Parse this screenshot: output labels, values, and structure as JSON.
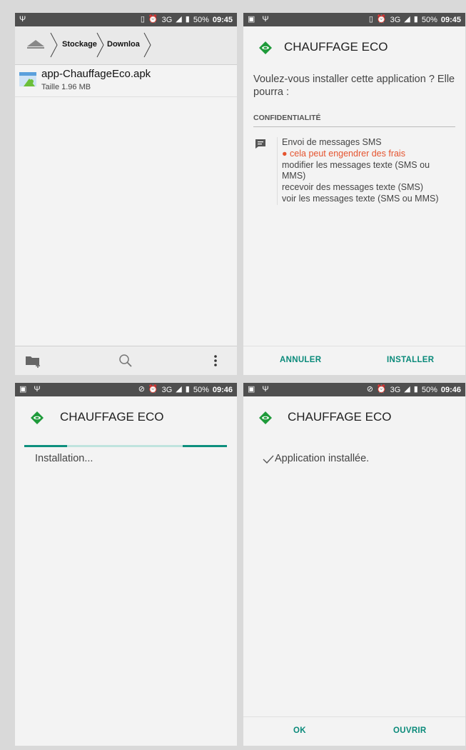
{
  "panels": {
    "file_manager": {
      "status": {
        "time": "09:45",
        "battery": "50%",
        "network": "3G"
      },
      "breadcrumb": [
        "Stockage",
        "Downloa"
      ],
      "file": {
        "name": "app-ChauffageEco.apk",
        "size": "Taille 1.96 MB"
      }
    },
    "installer_confirm": {
      "status": {
        "time": "09:45",
        "battery": "50%",
        "network": "3G"
      },
      "app_name": "CHAUFFAGE ECO",
      "question": "Voulez-vous installer cette application ? Elle pourra :",
      "section": "CONFIDENTIALITÉ",
      "permissions": {
        "sms_send": "Envoi de messages SMS",
        "warning": "cela peut engendrer des frais",
        "sms_modify": "modifier les messages texte (SMS ou MMS)",
        "sms_receive": "recevoir des messages texte (SMS)",
        "sms_read": "voir les messages texte (SMS ou MMS)"
      },
      "cancel_label": "ANNULER",
      "install_label": "INSTALLER"
    },
    "installing": {
      "status": {
        "time": "09:46",
        "battery": "50%",
        "network": "3G"
      },
      "app_name": "CHAUFFAGE ECO",
      "message": "Installation..."
    },
    "installed": {
      "status": {
        "time": "09:46",
        "battery": "50%",
        "network": "3G"
      },
      "app_name": "CHAUFFAGE ECO",
      "message": "Application installée.",
      "ok_label": "OK",
      "open_label": "OUVRIR"
    }
  },
  "colors": {
    "accent": "#0a8a7a",
    "warning": "#e5542f",
    "logo_green": "#1e9a3a",
    "statusbar": "#4f4f4f"
  }
}
